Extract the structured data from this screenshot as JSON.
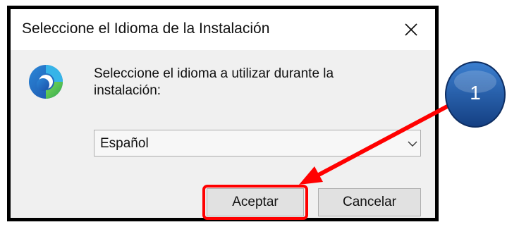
{
  "dialog": {
    "title": "Seleccione el Idioma de la Instalación",
    "message": "Seleccione el idioma a utilizar durante la instalación:",
    "language_select": {
      "selected": "Español"
    },
    "buttons": {
      "accept": "Aceptar",
      "cancel": "Cancelar"
    }
  },
  "annotation": {
    "step_number": "1",
    "highlight_color": "#ff0000",
    "badge_color": "#1f5fb4"
  },
  "icons": {
    "app": "app-logo-icon",
    "close": "close-icon",
    "dropdown": "chevron-down-icon"
  }
}
